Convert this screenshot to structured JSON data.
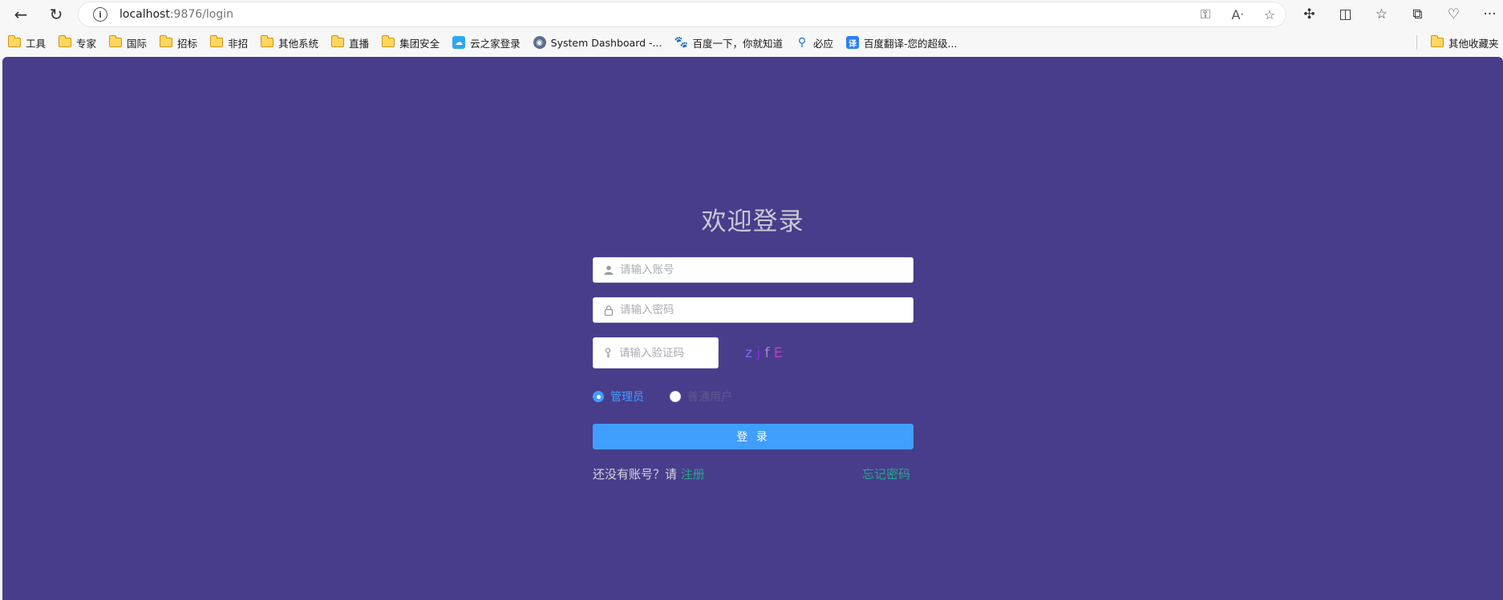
{
  "browser": {
    "url_host": "localhost",
    "url_rest": ":9876/login"
  },
  "bookmarks": [
    {
      "label": "工具",
      "type": "folder"
    },
    {
      "label": "专家",
      "type": "folder"
    },
    {
      "label": "国际",
      "type": "folder"
    },
    {
      "label": "招标",
      "type": "folder"
    },
    {
      "label": "非招",
      "type": "folder"
    },
    {
      "label": "其他系统",
      "type": "folder"
    },
    {
      "label": "直播",
      "type": "folder"
    },
    {
      "label": "集团安全",
      "type": "folder"
    },
    {
      "label": "云之家登录",
      "type": "site"
    },
    {
      "label": "System Dashboard -...",
      "type": "site"
    },
    {
      "label": "百度一下，你就知道",
      "type": "site"
    },
    {
      "label": "必应",
      "type": "site"
    },
    {
      "label": "百度翻译-您的超级...",
      "type": "site"
    }
  ],
  "bookmarks_other": "其他收藏夹",
  "login": {
    "title": "欢迎登录",
    "account_placeholder": "请输入账号",
    "password_placeholder": "请输入密码",
    "captcha_placeholder": "请输入验证码",
    "captcha_chars": [
      "z",
      "j",
      "f",
      "E"
    ],
    "captcha_colors": [
      "#7b68ee",
      "#8a2be2",
      "#b07fd0",
      "#c040c0"
    ],
    "role_admin": "管理员",
    "role_user": "普通用户",
    "selected_role": "管理员",
    "login_button": "登 录",
    "no_account_text": "还没有账号？请 ",
    "register_link": "注册",
    "forgot_link": "忘记密码"
  },
  "colors": {
    "page_bg": "#483d8b",
    "primary": "#409eff",
    "link": "#25a88a"
  }
}
